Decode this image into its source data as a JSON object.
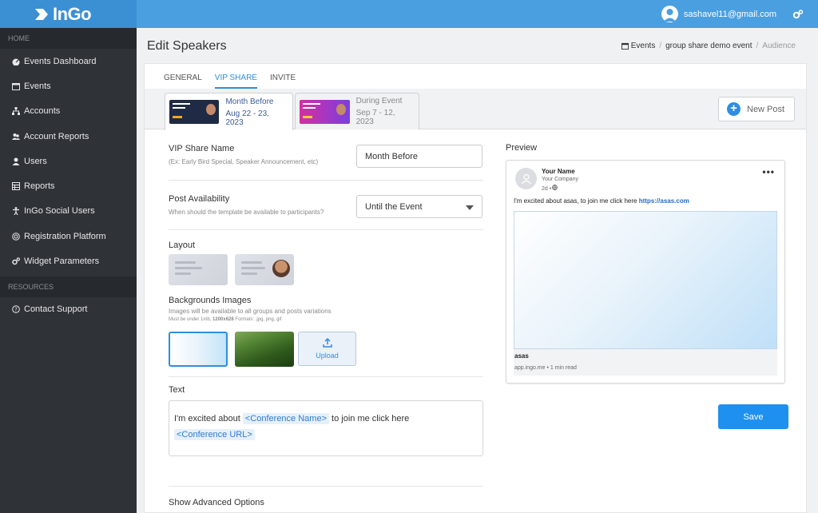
{
  "app": {
    "logo": "InGo",
    "user_email": "sashavel11@gmail.com"
  },
  "sidebar": {
    "sections": [
      {
        "title": "HOME"
      },
      {
        "title": "RESOURCES"
      }
    ],
    "items": [
      {
        "label": "Events Dashboard",
        "icon": "dashboard-icon"
      },
      {
        "label": "Events",
        "icon": "calendar-icon"
      },
      {
        "label": "Accounts",
        "icon": "sitemap-icon"
      },
      {
        "label": "Account Reports",
        "icon": "users-report-icon"
      },
      {
        "label": "Users",
        "icon": "user-icon"
      },
      {
        "label": "Reports",
        "icon": "table-icon"
      },
      {
        "label": "InGo Social Users",
        "icon": "person-icon"
      },
      {
        "label": "Registration Platform",
        "icon": "target-icon"
      },
      {
        "label": "Widget Parameters",
        "icon": "gears-icon"
      },
      {
        "label": "Contact Support",
        "icon": "question-icon"
      }
    ]
  },
  "page": {
    "title": "Edit Speakers",
    "breadcrumb": {
      "events": "Events",
      "event": "group share demo event",
      "current": "Audience",
      "sep": "/"
    }
  },
  "tabs": [
    "GENERAL",
    "VIP SHARE",
    "INVITE"
  ],
  "variants": [
    {
      "name": "Month Before",
      "dates": "Aug 22 - 23, 2023"
    },
    {
      "name": "During Event",
      "dates": "Sep 7 - 12, 2023"
    }
  ],
  "new_post_label": "New Post",
  "form": {
    "share_name": {
      "label": "VIP Share Name",
      "hint": "(Ex: Early Bird Special, Speaker Announcement, etc)",
      "value": "Month Before"
    },
    "availability": {
      "label": "Post Availability",
      "hint": "When should the template be available to participants?",
      "value": "Until the Event"
    },
    "layout_label": "Layout",
    "backgrounds": {
      "label": "Backgrounds Images",
      "hint": "Images will be available to all groups and posts variations",
      "size_note_a": "Must be under 1mb, ",
      "size_note_b": "1200x628",
      "size_note_c": " Formats: .jpg, png, gif",
      "upload_label": "Upload"
    },
    "text": {
      "label": "Text",
      "part1": "I'm excited about ",
      "tag1": "<Conference Name>",
      "part2": " to join me click here",
      "tag2": "<Conference URL>"
    },
    "advanced_label": "Show Advanced Options"
  },
  "preview": {
    "label": "Preview",
    "name": "Your Name",
    "company": "Your Company",
    "time": "2d •",
    "more": "•••",
    "text": "I'm excited about asas, to join me click here ",
    "link": "https://asas.com",
    "footer_title": "asas",
    "footer_sub": "app.ingo.me • 1 min read"
  },
  "save_label": "Save",
  "colors": {
    "accent": "#1e90f0",
    "topbar": "#4a9fe0",
    "sidebar": "#2f3237"
  }
}
